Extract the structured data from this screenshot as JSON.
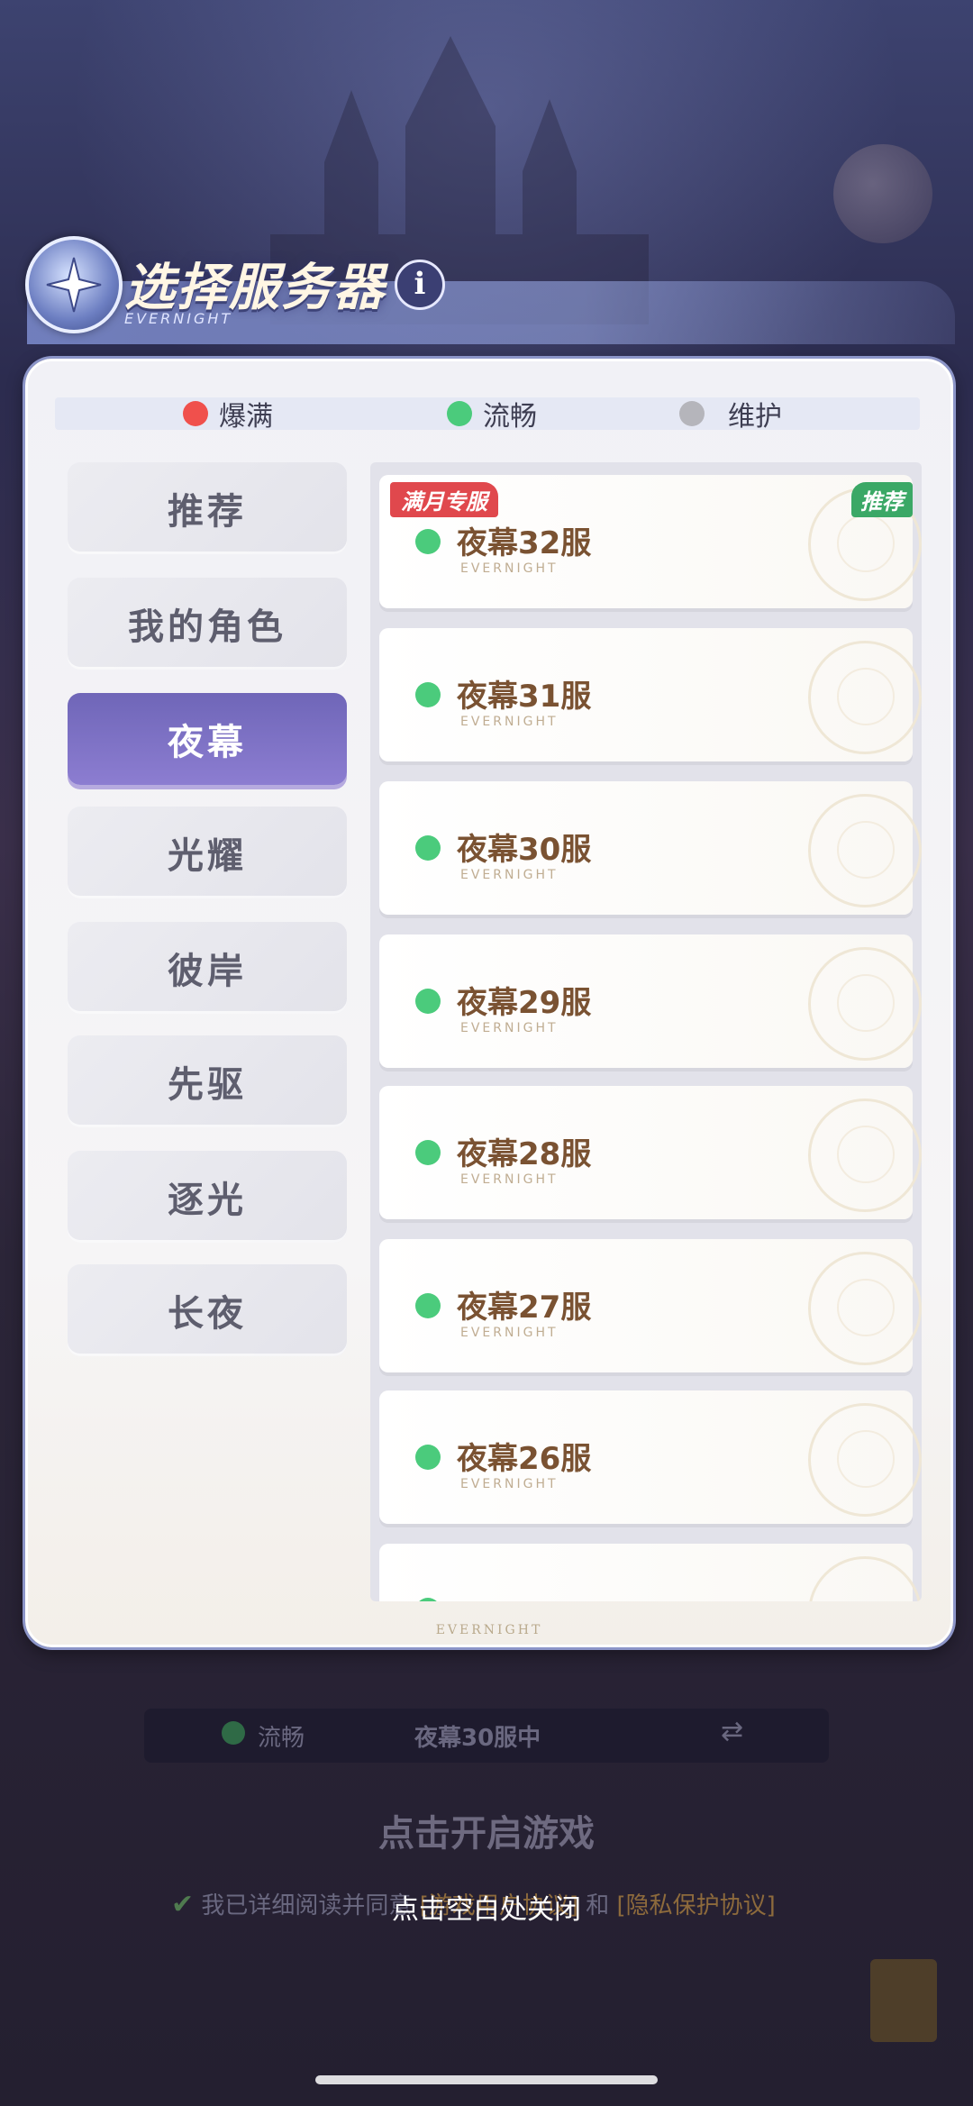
{
  "header": {
    "title": "选择服务器",
    "subtitle": "EVERNIGHT",
    "info_label": "i"
  },
  "legend": [
    {
      "label": "爆满",
      "color": "#f0504c"
    },
    {
      "label": "流畅",
      "color": "#4bcb7c"
    },
    {
      "label": "维护",
      "color": "#b5b5bb"
    }
  ],
  "tabs": [
    {
      "label": "推荐",
      "active": false
    },
    {
      "label": "我的角色",
      "active": false
    },
    {
      "label": "夜幕",
      "active": true
    },
    {
      "label": "光耀",
      "active": false
    },
    {
      "label": "彼岸",
      "active": false
    },
    {
      "label": "先驱",
      "active": false
    },
    {
      "label": "逐光",
      "active": false
    },
    {
      "label": "长夜",
      "active": false
    }
  ],
  "servers": [
    {
      "name": "夜幕32服",
      "sub": "EVERNIGHT",
      "status": "流畅",
      "tag_left": "满月专服",
      "tag_right": "推荐"
    },
    {
      "name": "夜幕31服",
      "sub": "EVERNIGHT",
      "status": "流畅"
    },
    {
      "name": "夜幕30服",
      "sub": "EVERNIGHT",
      "status": "流畅"
    },
    {
      "name": "夜幕29服",
      "sub": "EVERNIGHT",
      "status": "流畅"
    },
    {
      "name": "夜幕28服",
      "sub": "EVERNIGHT",
      "status": "流畅"
    },
    {
      "name": "夜幕27服",
      "sub": "EVERNIGHT",
      "status": "流畅"
    },
    {
      "name": "夜幕26服",
      "sub": "EVERNIGHT",
      "status": "流畅"
    }
  ],
  "panel_footer": "EVERNIGHT",
  "background": {
    "status_label": "流畅",
    "current_server": "夜幕30服中",
    "start_label": "点击开启游戏",
    "agree_prefix": "我已详细阅读并同意",
    "user_agreement": "[游戏用户协议]",
    "and": "和",
    "privacy_agreement": "[隐私保护协议]"
  },
  "close_hint": "点击空白处关闭"
}
